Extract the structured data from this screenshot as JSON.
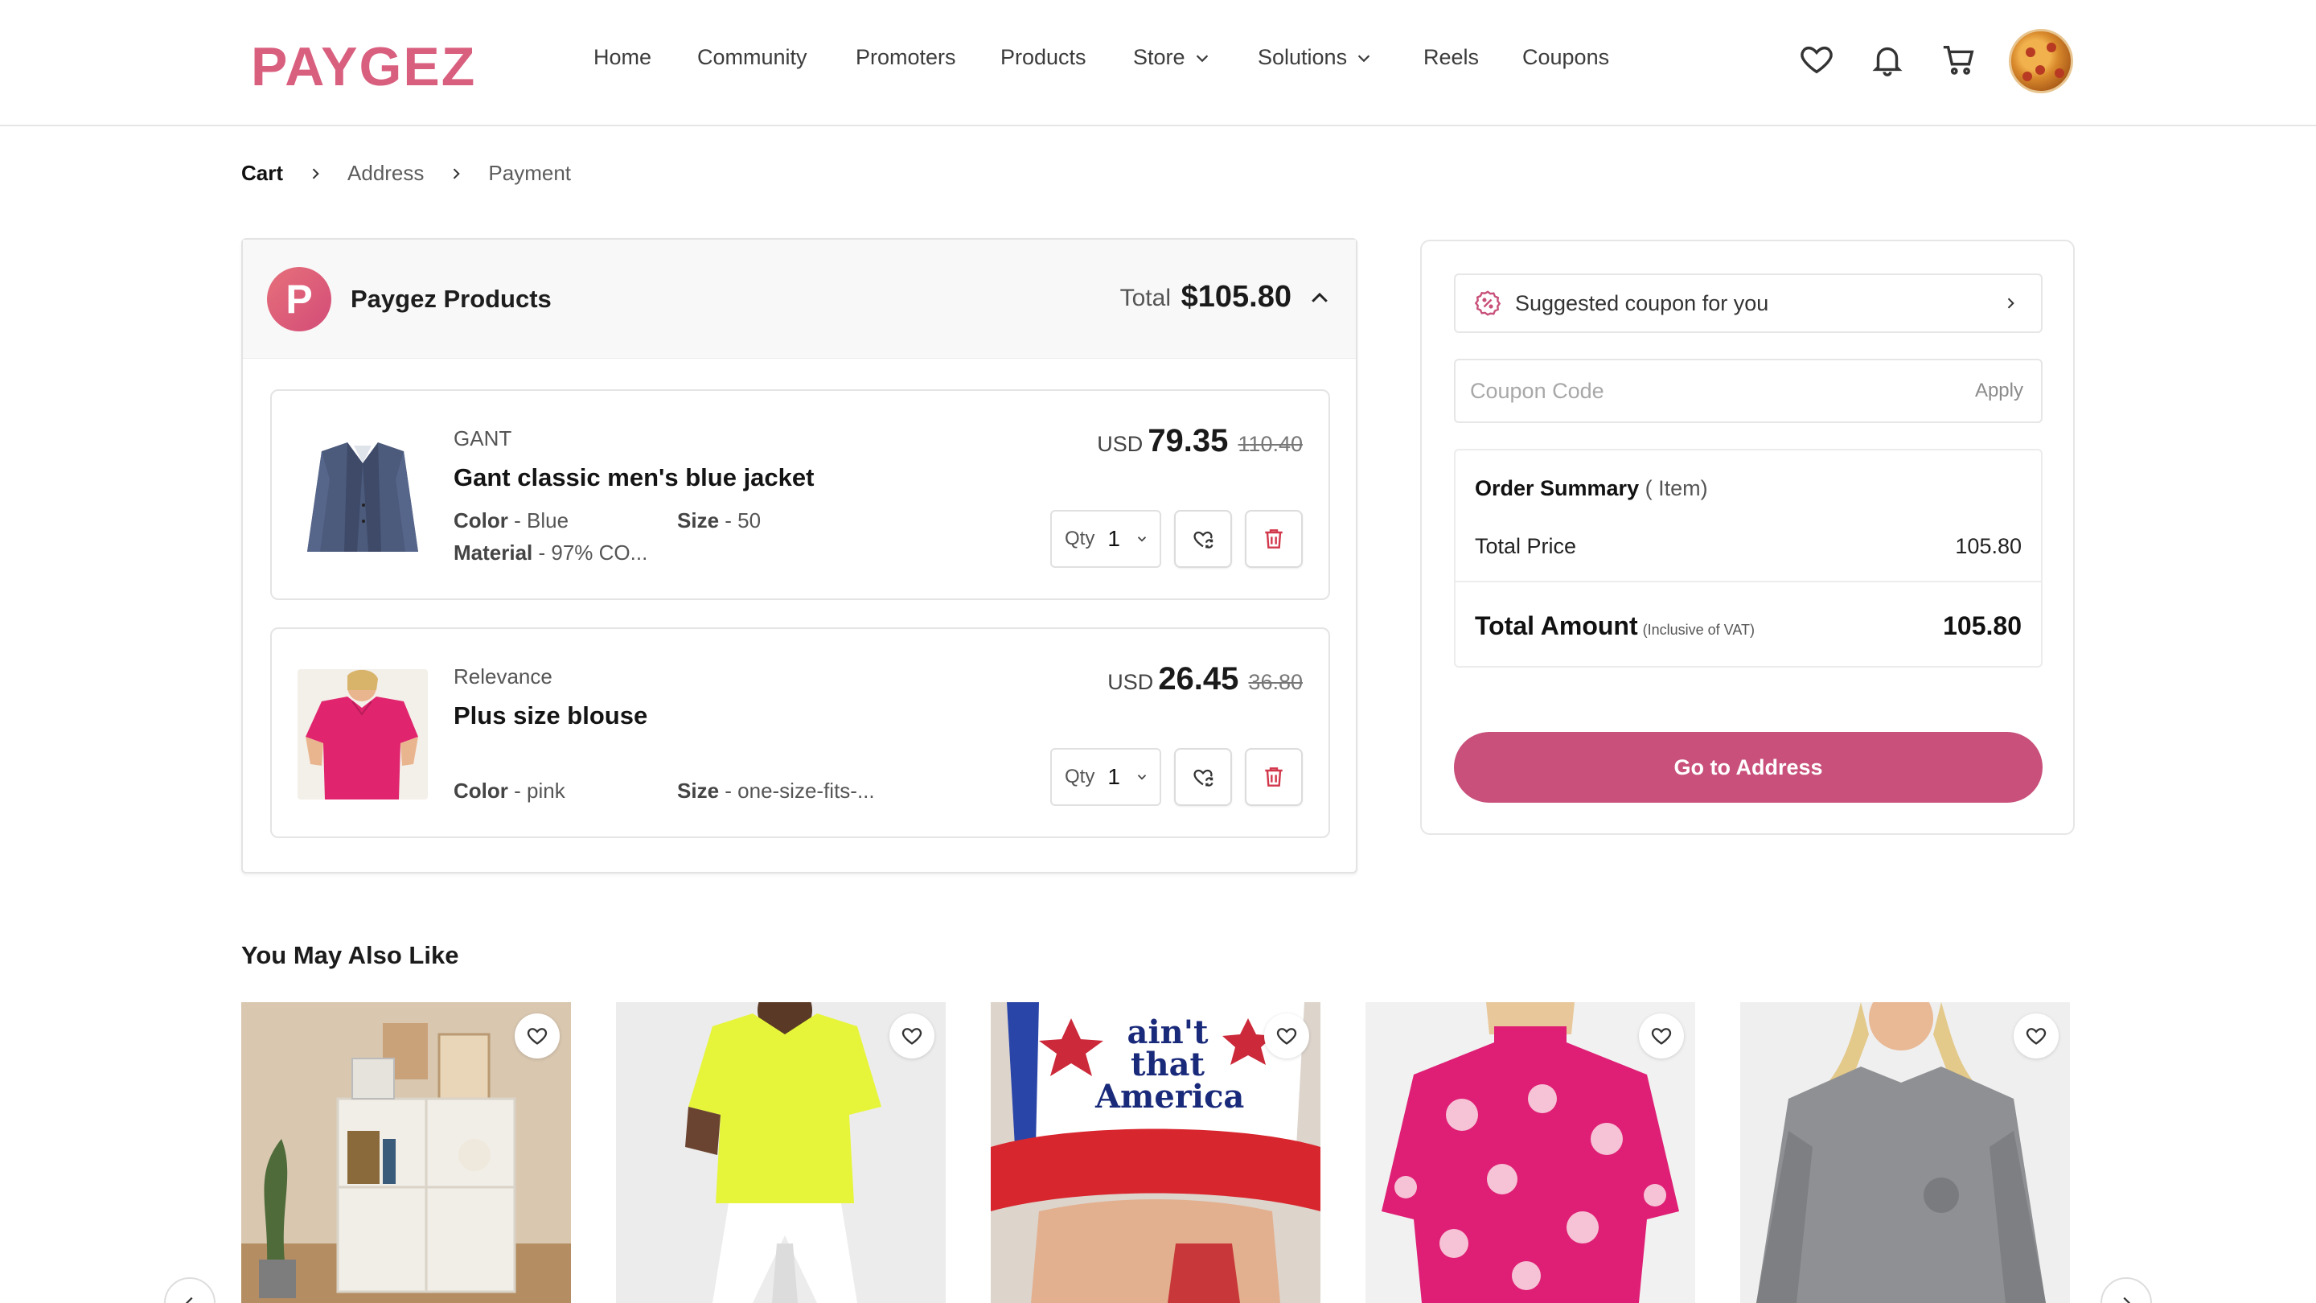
{
  "brand": {
    "logo_text": "PAYGEZ"
  },
  "nav": {
    "items": [
      {
        "label": "Home"
      },
      {
        "label": "Community"
      },
      {
        "label": "Promoters"
      },
      {
        "label": "Products"
      },
      {
        "label": "Store"
      },
      {
        "label": "Solutions"
      },
      {
        "label": "Reels"
      },
      {
        "label": "Coupons"
      }
    ]
  },
  "header_icons": [
    "heart-icon",
    "bell-icon",
    "cart-icon",
    "avatar"
  ],
  "breadcrumb": {
    "steps": [
      "Cart",
      "Address",
      "Payment"
    ],
    "active": "Cart"
  },
  "cart": {
    "store_name": "Paygez Products",
    "total_label": "Total",
    "total_value": "$105.80",
    "items": [
      {
        "brand": "GANT",
        "name": "Gant classic men's blue jacket",
        "attrs": [
          {
            "key": "Color",
            "value": "- Blue"
          },
          {
            "key": "Size",
            "value": "- 50"
          },
          {
            "key": "Material",
            "value": "- 97% CO..."
          }
        ],
        "currency": "USD",
        "price": "79.35",
        "old_price": "110.40",
        "qty_label": "Qty",
        "qty": "1"
      },
      {
        "brand": "Relevance",
        "name": "Plus size blouse",
        "attrs": [
          {
            "key": "Color",
            "value": "- pink"
          },
          {
            "key": "Size",
            "value": "- one-size-fits-..."
          }
        ],
        "currency": "USD",
        "price": "26.45",
        "old_price": "36.80",
        "qty_label": "Qty",
        "qty": "1"
      }
    ]
  },
  "summary": {
    "suggested_coupon": "Suggested coupon for you",
    "coupon_placeholder": "Coupon Code",
    "apply_label": "Apply",
    "order_summary_title": "Order Summary",
    "order_summary_sub": "( Item)",
    "total_price_label": "Total Price",
    "total_price_value": "105.80",
    "total_amount_label": "Total Amount",
    "total_amount_note": "(Inclusive of VAT)",
    "total_amount_value": "105.80",
    "cta": "Go to Address"
  },
  "recommendations": {
    "title": "You May Also Like",
    "items": [
      "shelf-product",
      "neon-top-product",
      "trucker-cap-product",
      "polka-sweater-product",
      "grey-sweater-product"
    ]
  },
  "colors": {
    "accent": "#c8507a",
    "logo": "#d95f7f",
    "trash": "#d2384c"
  }
}
